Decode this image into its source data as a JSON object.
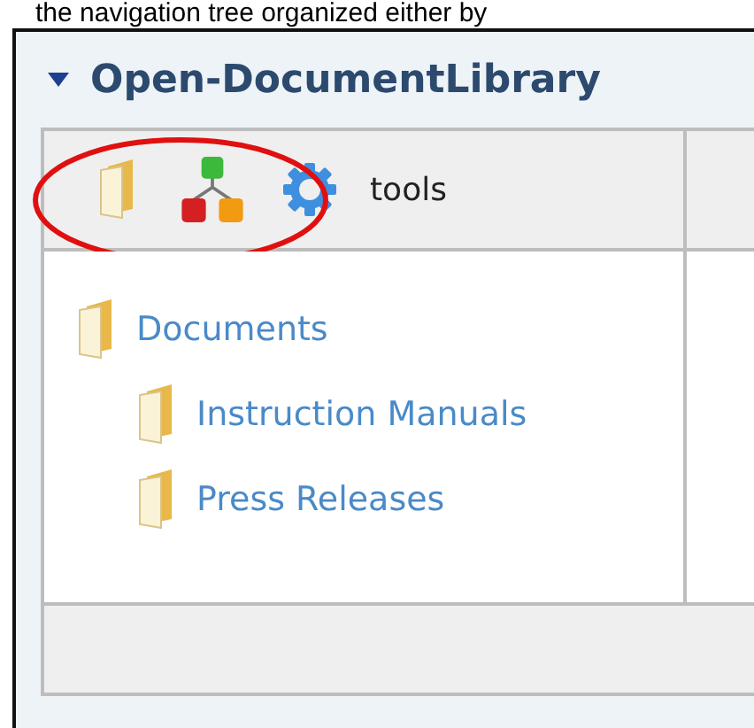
{
  "caption": "the navigation tree organized either by",
  "panel": {
    "title": "Open-DocumentLibrary",
    "expanded": true
  },
  "toolbar": {
    "label": "tools"
  },
  "tree": [
    {
      "label": "Documents",
      "children": [
        {
          "label": "Instruction Manuals"
        },
        {
          "label": "Press Releases"
        }
      ]
    }
  ]
}
